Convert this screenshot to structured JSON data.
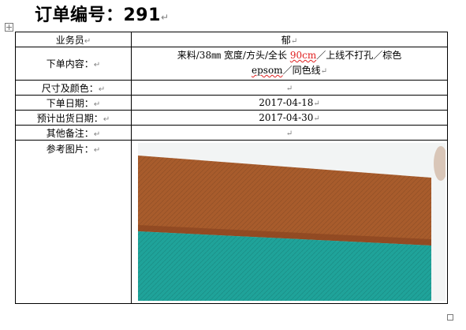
{
  "title": "订单编号：291",
  "paragraph_mark": "↵",
  "table": {
    "salesperson_label": "业务员",
    "salesperson_value": "郁",
    "content_label": "下单内容：",
    "content_line1_a": "来料/38",
    "content_line1_mm": "㎜",
    "content_line1_b": " 宽度/方头/全长 ",
    "content_line1_len": "90cm",
    "content_line1_c": "／上线不打孔／棕色",
    "content_line2_a": "epsom",
    "content_line2_b": "／同色线",
    "size_color_label": "尺寸及颜色：",
    "size_color_value": "",
    "order_date_label": "下单日期：",
    "order_date_value": "2017-04-18",
    "ship_date_label": "预计出货日期：",
    "ship_date_value": "2017-04-30",
    "notes_label": "其他备注：",
    "notes_value": "",
    "reference_label": "参考图片："
  },
  "photo": {
    "colors": {
      "background": "#f2f4f4",
      "brown_strap": "#a85c2c",
      "brown_edge": "#8a4520",
      "teal_strap": "#1fa39a",
      "finger": "#d9c6b8"
    }
  }
}
